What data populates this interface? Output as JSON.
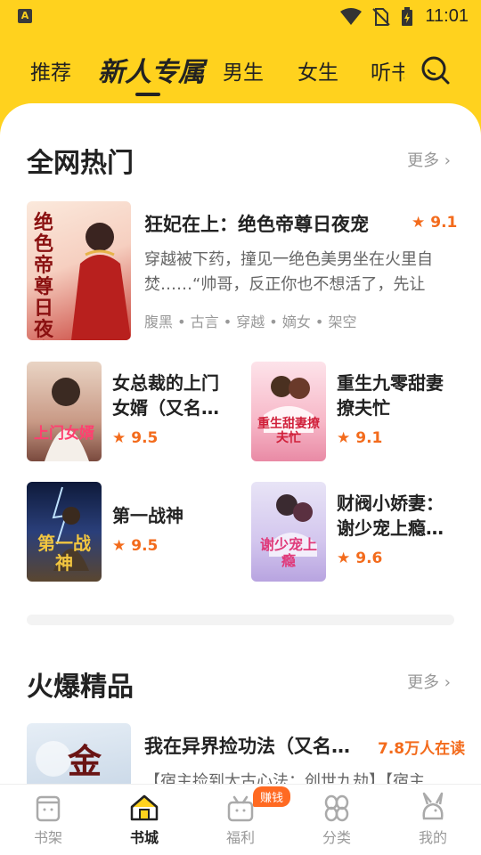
{
  "status_bar": {
    "app_icon_letter": "A",
    "time": "11:01"
  },
  "top_nav": {
    "tabs": [
      {
        "label": "推荐"
      },
      {
        "label": "新人专属",
        "active": true
      },
      {
        "label": "男生"
      },
      {
        "label": "女生"
      },
      {
        "label": "听书"
      }
    ],
    "search_icon": "search-icon"
  },
  "section_hot": {
    "title": "全网热门",
    "more_label": "更多",
    "featured": {
      "title": "狂妃在上：绝色帝尊日夜宠",
      "rating": "9.1",
      "description": "穿越被下药，撞见一绝色美男坐在火里自焚……“帅哥，反正你也不想活了，先让我……",
      "tags": "腹黑 • 古言 • 穿越 • 嫡女 • 架空",
      "cover_text": "绝色帝尊日夜宠"
    },
    "books": [
      {
        "title": "女总裁的上门女婿（又名…",
        "rating": "9.5",
        "cover_text": "上门女婿"
      },
      {
        "title": "重生九零甜妻撩夫忙",
        "rating": "9.1",
        "cover_text": "重生甜妻撩夫忙"
      },
      {
        "title": "第一战神",
        "rating": "9.5",
        "cover_text": "第一战神"
      },
      {
        "title": "财阀小娇妻：谢少宠上瘾…",
        "rating": "9.6",
        "cover_text": "谢少宠上瘾"
      }
    ]
  },
  "section_boutique": {
    "title": "火爆精品",
    "more_label": "更多",
    "featured": {
      "title": "我在异界捡功法（又名…",
      "readers": "7.8万人在读",
      "description": "【宿主捡到太古心法：创世九劫】【宿主",
      "cover_text": "金"
    }
  },
  "bottom_nav": {
    "items": [
      {
        "label": "书架"
      },
      {
        "label": "书城",
        "active": true
      },
      {
        "label": "福利",
        "badge": "赚钱"
      },
      {
        "label": "分类"
      },
      {
        "label": "我的"
      }
    ]
  },
  "colors": {
    "accent": "#ffd21e",
    "rating": "#f36b1c"
  }
}
